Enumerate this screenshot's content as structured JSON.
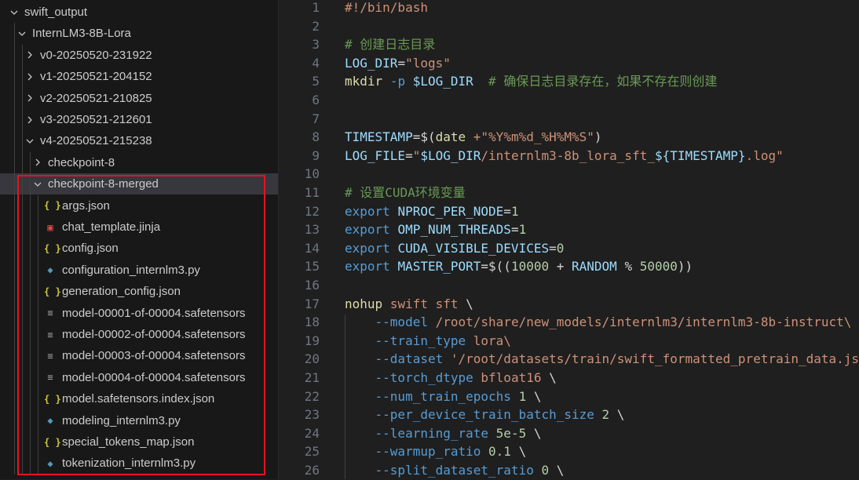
{
  "explorer": {
    "items": [
      {
        "label": "swift_output",
        "depth": 0,
        "kind": "folder",
        "open": true
      },
      {
        "label": "InternLM3-8B-Lora",
        "depth": 1,
        "kind": "folder",
        "open": true
      },
      {
        "label": "v0-20250520-231922",
        "depth": 2,
        "kind": "folder",
        "open": false
      },
      {
        "label": "v1-20250521-204152",
        "depth": 2,
        "kind": "folder",
        "open": false
      },
      {
        "label": "v2-20250521-210825",
        "depth": 2,
        "kind": "folder",
        "open": false
      },
      {
        "label": "v3-20250521-212601",
        "depth": 2,
        "kind": "folder",
        "open": false
      },
      {
        "label": "v4-20250521-215238",
        "depth": 2,
        "kind": "folder",
        "open": true
      },
      {
        "label": "checkpoint-8",
        "depth": 3,
        "kind": "folder",
        "open": false
      },
      {
        "label": "checkpoint-8-merged",
        "depth": 3,
        "kind": "folder",
        "open": true,
        "selected": true
      },
      {
        "label": "args.json",
        "depth": 4,
        "kind": "json"
      },
      {
        "label": "chat_template.jinja",
        "depth": 4,
        "kind": "jinja"
      },
      {
        "label": "config.json",
        "depth": 4,
        "kind": "json"
      },
      {
        "label": "configuration_internlm3.py",
        "depth": 4,
        "kind": "py"
      },
      {
        "label": "generation_config.json",
        "depth": 4,
        "kind": "json"
      },
      {
        "label": "model-00001-of-00004.safetensors",
        "depth": 4,
        "kind": "file"
      },
      {
        "label": "model-00002-of-00004.safetensors",
        "depth": 4,
        "kind": "file"
      },
      {
        "label": "model-00003-of-00004.safetensors",
        "depth": 4,
        "kind": "file"
      },
      {
        "label": "model-00004-of-00004.safetensors",
        "depth": 4,
        "kind": "file"
      },
      {
        "label": "model.safetensors.index.json",
        "depth": 4,
        "kind": "json"
      },
      {
        "label": "modeling_internlm3.py",
        "depth": 4,
        "kind": "py"
      },
      {
        "label": "special_tokens_map.json",
        "depth": 4,
        "kind": "json"
      },
      {
        "label": "tokenization_internlm3.py",
        "depth": 4,
        "kind": "py"
      }
    ],
    "highlight_color": "#e81123"
  },
  "editor": {
    "lines": [
      {
        "n": "1",
        "tokens": [
          {
            "t": "#!/bin/bash",
            "c": "she"
          }
        ]
      },
      {
        "n": "2",
        "tokens": []
      },
      {
        "n": "3",
        "tokens": [
          {
            "t": "# 创建日志目录",
            "c": "com"
          }
        ]
      },
      {
        "n": "4",
        "tokens": [
          {
            "t": "LOG_DIR",
            "c": "var"
          },
          {
            "t": "=",
            "c": "op"
          },
          {
            "t": "\"logs\"",
            "c": "str"
          }
        ]
      },
      {
        "n": "5",
        "tokens": [
          {
            "t": "mkdir",
            "c": "fn"
          },
          {
            "t": " ",
            "c": "op"
          },
          {
            "t": "-p",
            "c": "kw"
          },
          {
            "t": " ",
            "c": "op"
          },
          {
            "t": "$LOG_DIR",
            "c": "var"
          },
          {
            "t": "  ",
            "c": "op"
          },
          {
            "t": "# 确保日志目录存在，如果不存在则创建",
            "c": "com"
          }
        ]
      },
      {
        "n": "6",
        "tokens": []
      },
      {
        "n": "7",
        "tokens": []
      },
      {
        "n": "8",
        "tokens": [
          {
            "t": "TIMESTAMP",
            "c": "var"
          },
          {
            "t": "=$(",
            "c": "op"
          },
          {
            "t": "date",
            "c": "fn"
          },
          {
            "t": " ",
            "c": "op"
          },
          {
            "t": "+\"%Y%m%d_%H%M%S\"",
            "c": "str"
          },
          {
            "t": ")",
            "c": "op"
          }
        ]
      },
      {
        "n": "9",
        "tokens": [
          {
            "t": "LOG_FILE",
            "c": "var"
          },
          {
            "t": "=",
            "c": "op"
          },
          {
            "t": "\"",
            "c": "str"
          },
          {
            "t": "$LOG_DIR",
            "c": "var"
          },
          {
            "t": "/internlm3-8b_lora_sft_",
            "c": "str"
          },
          {
            "t": "${TIMESTAMP}",
            "c": "var"
          },
          {
            "t": ".log\"",
            "c": "str"
          }
        ]
      },
      {
        "n": "10",
        "tokens": []
      },
      {
        "n": "11",
        "tokens": [
          {
            "t": "# 设置CUDA环境变量",
            "c": "com"
          }
        ]
      },
      {
        "n": "12",
        "tokens": [
          {
            "t": "export",
            "c": "kw"
          },
          {
            "t": " ",
            "c": "op"
          },
          {
            "t": "NPROC_PER_NODE",
            "c": "var"
          },
          {
            "t": "=",
            "c": "op"
          },
          {
            "t": "1",
            "c": "num"
          }
        ]
      },
      {
        "n": "13",
        "tokens": [
          {
            "t": "export",
            "c": "kw"
          },
          {
            "t": " ",
            "c": "op"
          },
          {
            "t": "OMP_NUM_THREADS",
            "c": "var"
          },
          {
            "t": "=",
            "c": "op"
          },
          {
            "t": "1",
            "c": "num"
          }
        ]
      },
      {
        "n": "14",
        "tokens": [
          {
            "t": "export",
            "c": "kw"
          },
          {
            "t": " ",
            "c": "op"
          },
          {
            "t": "CUDA_VISIBLE_DEVICES",
            "c": "var"
          },
          {
            "t": "=",
            "c": "op"
          },
          {
            "t": "0",
            "c": "num"
          }
        ]
      },
      {
        "n": "15",
        "tokens": [
          {
            "t": "export",
            "c": "kw"
          },
          {
            "t": " ",
            "c": "op"
          },
          {
            "t": "MASTER_PORT",
            "c": "var"
          },
          {
            "t": "=$((",
            "c": "op"
          },
          {
            "t": "10000",
            "c": "num"
          },
          {
            "t": " + ",
            "c": "op"
          },
          {
            "t": "RANDOM",
            "c": "var"
          },
          {
            "t": " % ",
            "c": "op"
          },
          {
            "t": "50000",
            "c": "num"
          },
          {
            "t": "))",
            "c": "op"
          }
        ]
      },
      {
        "n": "16",
        "tokens": []
      },
      {
        "n": "17",
        "tokens": [
          {
            "t": "nohup",
            "c": "fn"
          },
          {
            "t": " ",
            "c": "op"
          },
          {
            "t": "swift sft",
            "c": "str"
          },
          {
            "t": " \\",
            "c": "op"
          }
        ]
      },
      {
        "n": "18",
        "tokens": [
          {
            "t": "    ",
            "c": "op"
          },
          {
            "t": "--model",
            "c": "kw"
          },
          {
            "t": " ",
            "c": "op"
          },
          {
            "t": "/root/share/new_models/internlm3/internlm3-8b-instruct\\",
            "c": "str"
          }
        ]
      },
      {
        "n": "19",
        "tokens": [
          {
            "t": "    ",
            "c": "op"
          },
          {
            "t": "--train_type",
            "c": "kw"
          },
          {
            "t": " ",
            "c": "op"
          },
          {
            "t": "lora\\",
            "c": "str"
          }
        ]
      },
      {
        "n": "20",
        "tokens": [
          {
            "t": "    ",
            "c": "op"
          },
          {
            "t": "--dataset",
            "c": "kw"
          },
          {
            "t": " ",
            "c": "op"
          },
          {
            "t": "'/root/datasets/train/swift_formatted_pretrain_data.js",
            "c": "str"
          }
        ]
      },
      {
        "n": "21",
        "tokens": [
          {
            "t": "    ",
            "c": "op"
          },
          {
            "t": "--torch_dtype",
            "c": "kw"
          },
          {
            "t": " ",
            "c": "op"
          },
          {
            "t": "bfloat16",
            "c": "str"
          },
          {
            "t": " \\",
            "c": "op"
          }
        ]
      },
      {
        "n": "22",
        "tokens": [
          {
            "t": "    ",
            "c": "op"
          },
          {
            "t": "--num_train_epochs",
            "c": "kw"
          },
          {
            "t": " ",
            "c": "op"
          },
          {
            "t": "1",
            "c": "num"
          },
          {
            "t": " \\",
            "c": "op"
          }
        ]
      },
      {
        "n": "23",
        "tokens": [
          {
            "t": "    ",
            "c": "op"
          },
          {
            "t": "--per_device_train_batch_size",
            "c": "kw"
          },
          {
            "t": " ",
            "c": "op"
          },
          {
            "t": "2",
            "c": "num"
          },
          {
            "t": " \\",
            "c": "op"
          }
        ]
      },
      {
        "n": "24",
        "tokens": [
          {
            "t": "    ",
            "c": "op"
          },
          {
            "t": "--learning_rate",
            "c": "kw"
          },
          {
            "t": " ",
            "c": "op"
          },
          {
            "t": "5e-5",
            "c": "num"
          },
          {
            "t": " \\",
            "c": "op"
          }
        ]
      },
      {
        "n": "25",
        "tokens": [
          {
            "t": "    ",
            "c": "op"
          },
          {
            "t": "--warmup_ratio",
            "c": "kw"
          },
          {
            "t": " ",
            "c": "op"
          },
          {
            "t": "0.1",
            "c": "num"
          },
          {
            "t": " \\",
            "c": "op"
          }
        ]
      },
      {
        "n": "26",
        "tokens": [
          {
            "t": "    ",
            "c": "op"
          },
          {
            "t": "--split_dataset_ratio",
            "c": "kw"
          },
          {
            "t": " ",
            "c": "op"
          },
          {
            "t": "0",
            "c": "num"
          },
          {
            "t": " \\",
            "c": "op"
          }
        ]
      }
    ]
  }
}
